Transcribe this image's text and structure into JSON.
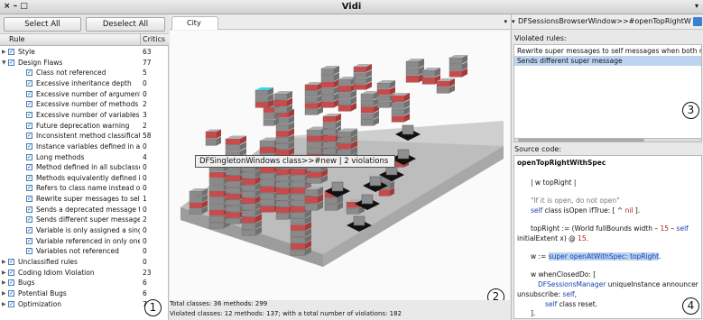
{
  "window": {
    "title": "Vidi",
    "controls": "× – □",
    "menu_arrow": "▾"
  },
  "left_panel": {
    "select_all": "Select All",
    "deselect_all": "Deselect All",
    "col_rule": "Rule",
    "col_critics": "Critics",
    "rules": [
      {
        "label": "Style",
        "count": "63",
        "level": 0,
        "expanded": false
      },
      {
        "label": "Design Flaws",
        "count": "77",
        "level": 0,
        "expanded": true
      },
      {
        "label": "Class not referenced",
        "count": "5",
        "level": 1
      },
      {
        "label": "Excessive inheritance depth",
        "count": "0",
        "level": 1
      },
      {
        "label": "Excessive number of arguments",
        "count": "0",
        "level": 1
      },
      {
        "label": "Excessive number of methods",
        "count": "2",
        "level": 1
      },
      {
        "label": "Excessive number of variables",
        "count": "3",
        "level": 1
      },
      {
        "label": "Future deprecation warning",
        "count": "2",
        "level": 1
      },
      {
        "label": "Inconsistent method classificatio",
        "count": "58",
        "level": 1
      },
      {
        "label": "Instance variables defined in all s",
        "count": "0",
        "level": 1
      },
      {
        "label": "Long methods",
        "count": "4",
        "level": 1
      },
      {
        "label": "Method defined in all subclasses.",
        "count": "0",
        "level": 1
      },
      {
        "label": "Methods equivalently defined in",
        "count": "0",
        "level": 1
      },
      {
        "label": "Refers to class name instead of",
        "count": "0",
        "level": 1
      },
      {
        "label": "Rewrite super messages to self m",
        "count": "1",
        "level": 1
      },
      {
        "label": "Sends a deprecated message to",
        "count": "0",
        "level": 1
      },
      {
        "label": "Sends different super message",
        "count": "2",
        "level": 1
      },
      {
        "label": "Variable is only assigned a single",
        "count": "0",
        "level": 1
      },
      {
        "label": "Variable referenced in only one m",
        "count": "0",
        "level": 1
      },
      {
        "label": "Variables not referenced",
        "count": "0",
        "level": 1
      },
      {
        "label": "Unclassified rules",
        "count": "0",
        "level": 0,
        "expanded": false
      },
      {
        "label": "Coding Idiom Violation",
        "count": "23",
        "level": 0,
        "expanded": false
      },
      {
        "label": "Bugs",
        "count": "6",
        "level": 0,
        "expanded": false
      },
      {
        "label": "Potential Bugs",
        "count": "6",
        "level": 0,
        "expanded": false
      },
      {
        "label": "Optimization",
        "count": "7",
        "level": 0,
        "expanded": false
      }
    ],
    "badge": "1"
  },
  "center_panel": {
    "tab_label": "City",
    "tab_arrow": "▾",
    "tooltip": "DFSingletonWindows class>>#new | 2 violations",
    "total_classes": "Total classes: 36 methods: 299",
    "violated_classes": "Violated classes: 12 methods: 137; with a total number of violations: 182",
    "badge": "2"
  },
  "right_panel": {
    "title": "DFSessionsBrowserWindow>>#openTopRightWithSpec",
    "violated_label": "Violated rules:",
    "violated_rules": [
      "Rewrite super messages to self messages when both refer to same method",
      "Sends different super message"
    ],
    "selected_index": 1,
    "source_label": "Source code:",
    "source": {
      "method": "openTopRightWithSpec",
      "temps": "| w topRight |",
      "comment": "\"If it is open, do not open\"",
      "l_if_a": "self",
      "l_if_b": " class isOpen ifTrue: [ ^ ",
      "l_if_c": "nil",
      "l_if_d": " ].",
      "l_tr1_a": "topRight := (World fullBounds width – ",
      "l_tr1_b": "15",
      "l_tr1_c": " – ",
      "l_tr1_d": "self",
      "l_tr2_a": "initialExtent x) @ ",
      "l_tr2_b": "15",
      "l_tr2_c": ".",
      "l_w_a": "w := ",
      "l_w_b": "super openAtWithSpec: topRight",
      "l_w_c": ".",
      "l_wc": "w whenClosedDo: [",
      "l_dfs_a": "DFSessionsManager",
      "l_dfs_b": " uniqueInstance announcer",
      "l_unsub_a": "unsubscribe: ",
      "l_unsub_b": "self",
      "l_unsub_c": ",",
      "l_reset_a": "self",
      "l_reset_b": " class reset.",
      "l_close": "]."
    },
    "badge_top": "3",
    "badge_bottom": "4"
  },
  "colors": {
    "violation": "#c94a4a",
    "building": "#8a8a8a",
    "selected": "#39d6e6",
    "selection_row": "#bcd4f0"
  }
}
